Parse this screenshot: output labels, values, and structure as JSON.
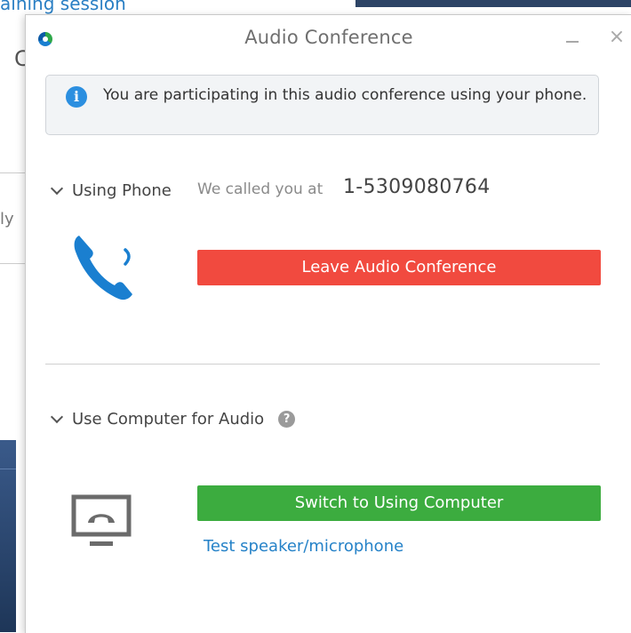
{
  "background": {
    "link_text": "aining session",
    "partial_text_1": "C",
    "partial_text_2": "ly"
  },
  "dialog": {
    "title": "Audio Conference",
    "minimize_icon": "minimize-icon",
    "close_label": "×",
    "notice": {
      "icon": "info-icon",
      "icon_glyph": "i",
      "text": "You are participating in this audio conference using your phone."
    },
    "phone_section": {
      "label": "Using Phone",
      "called_prefix": "We called you at",
      "phone_number": "1-5309080764",
      "icon": "phone-call-icon",
      "leave_button": "Leave Audio Conference"
    },
    "computer_section": {
      "label": "Use Computer for Audio",
      "help_icon": "help-icon",
      "help_glyph": "?",
      "icon": "computer-audio-icon",
      "switch_button": "Switch to Using Computer",
      "test_link": "Test speaker/microphone"
    }
  },
  "colors": {
    "leave_button": "#f14a3f",
    "switch_button": "#3cac3f",
    "link": "#2582c8",
    "phone_icon": "#1a7fd0",
    "info_icon": "#2c8fe0"
  }
}
